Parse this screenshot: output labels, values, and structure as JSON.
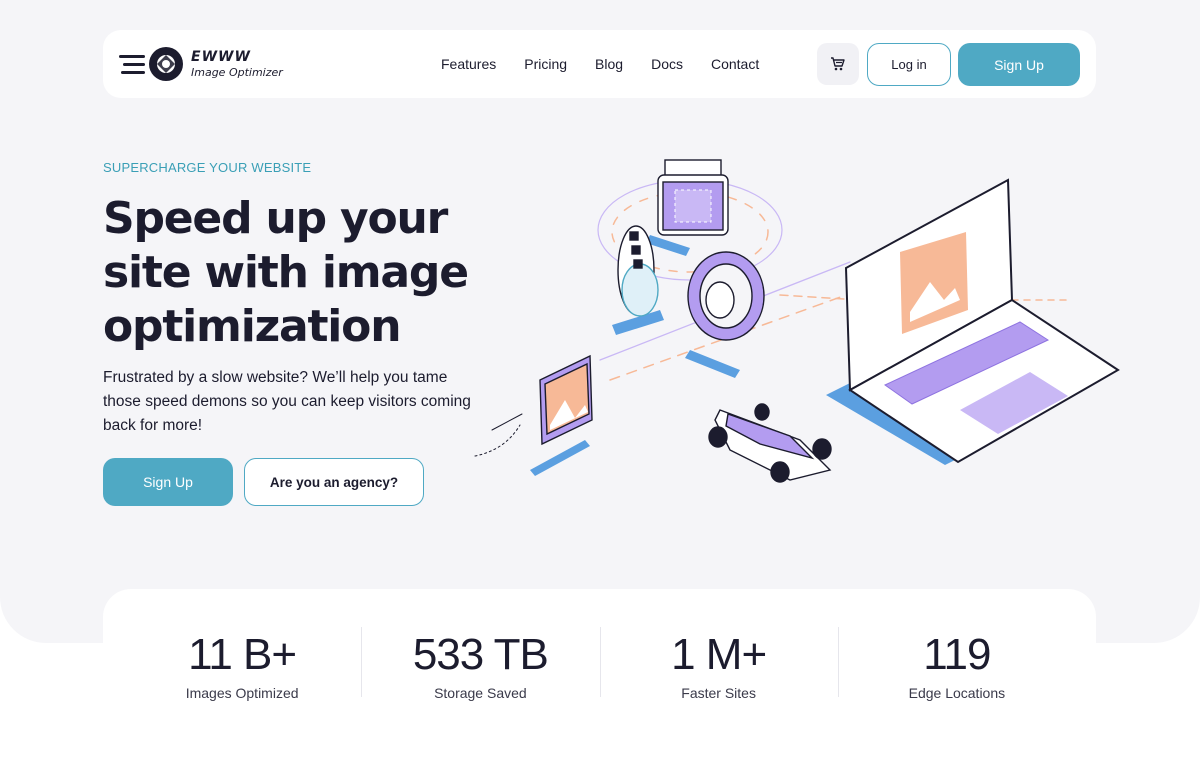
{
  "nav": {
    "logo_name": "EWWW",
    "logo_sub": "Image Optimizer",
    "menu": [
      "Features",
      "Pricing",
      "Blog",
      "Docs",
      "Contact"
    ],
    "cart_icon": "cart-icon",
    "login_label": "Log in",
    "signup_label": "Sign Up"
  },
  "hero": {
    "eyebrow": "SUPERCHARGE YOUR WEBSITE",
    "headline": "Speed up your site with image optimization",
    "subtext": "Frustrated by a slow website? We’ll help you tame those speed demons so you can keep visitors coming back for more!",
    "signup_label": "Sign Up",
    "agency_label": "Are you an agency?"
  },
  "stats": [
    {
      "value": "11 B+",
      "label": "Images Optimized"
    },
    {
      "value": "533 TB",
      "label": "Storage Saved"
    },
    {
      "value": "1 M+",
      "label": "Faster Sites"
    },
    {
      "value": "119",
      "label": "Edge Locations"
    }
  ],
  "colors": {
    "accent": "#4fa9c4",
    "text": "#1c1c2e",
    "purple": "#b39cf0",
    "peach": "#f7b997",
    "blue": "#5b9fe0"
  }
}
